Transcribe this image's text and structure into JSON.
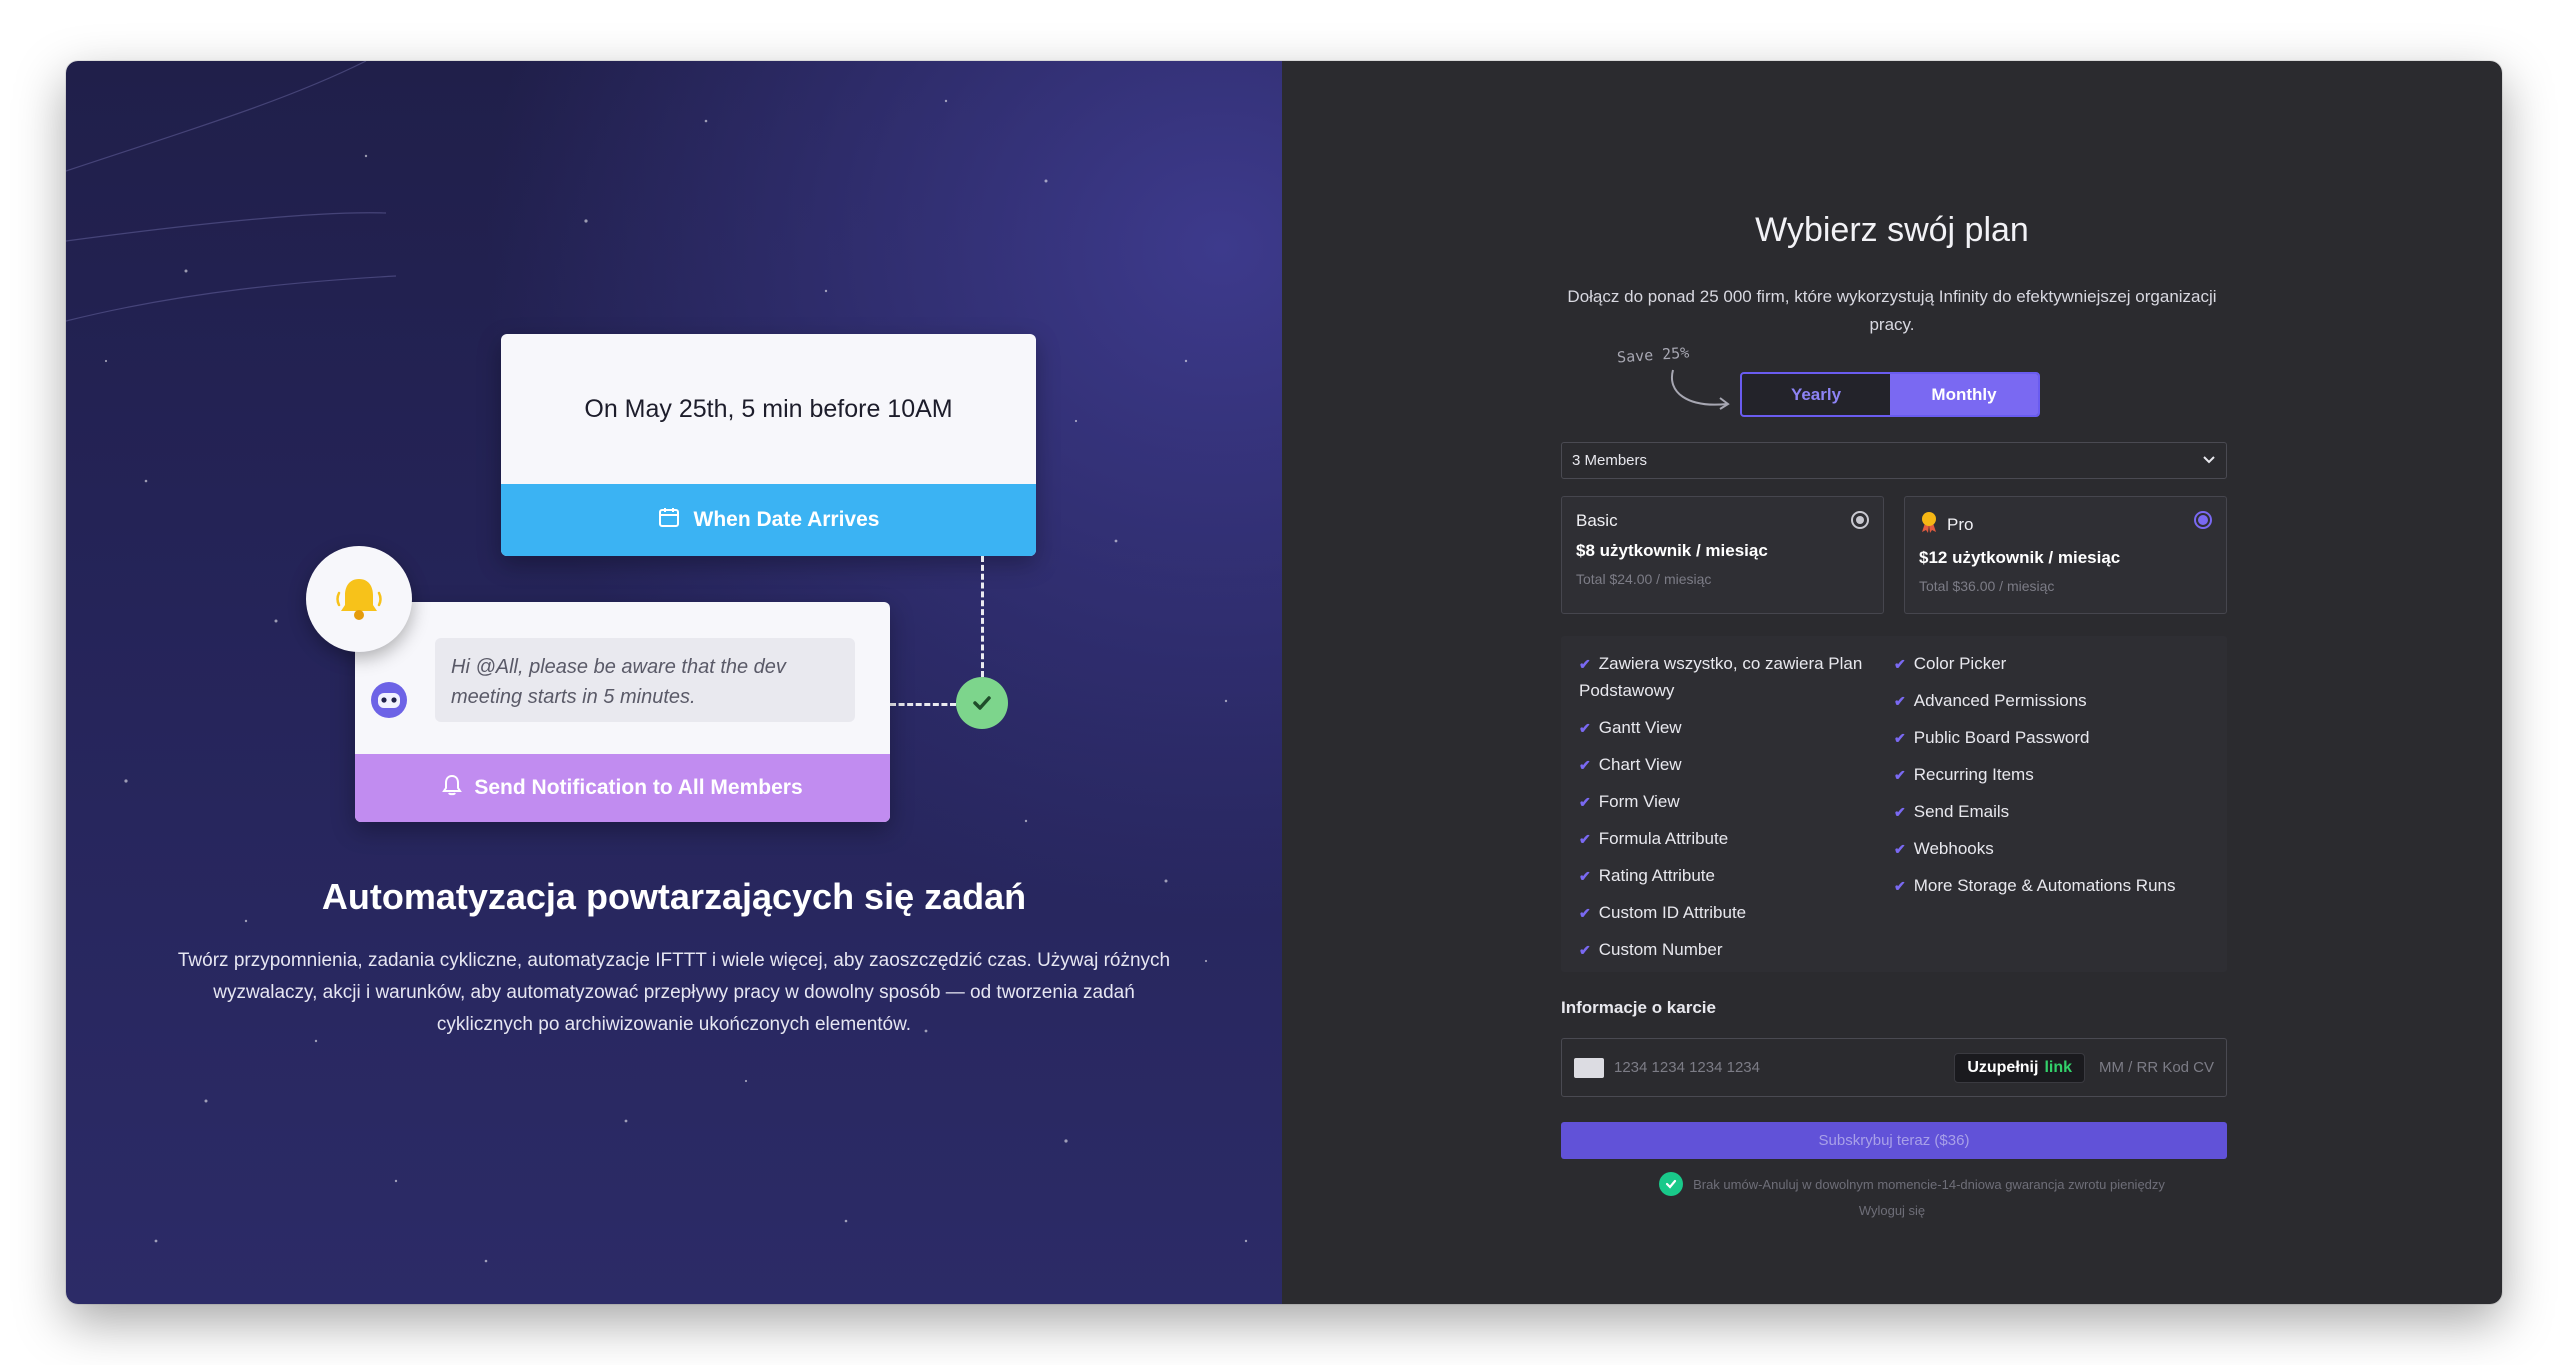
{
  "left": {
    "trigger_text": "On May 25th, 5 min before 10AM",
    "trigger_bar": "When Date Arrives",
    "message": "Hi @All, please be aware that the dev meeting starts in 5 minutes.",
    "notify_bar": "Send Notification to All Members",
    "title": "Automatyzacja powtarzających się zadań",
    "description": "Twórz przypomnienia, zadania cykliczne, automatyzacje IFTTT i wiele więcej, aby zaoszczędzić czas. Używaj różnych wyzwalaczy, akcji i warunków, aby automatyzować przepływy pracy w dowolny sposób — od tworzenia zadań cyklicznych po archiwizowanie ukończonych elementów."
  },
  "right": {
    "title": "Wybierz swój plan",
    "subtitle": "Dołącz do ponad 25 000 firm, które wykorzystują Infinity do efektywniejszej organizacji pracy.",
    "save_note": "Save 25%",
    "billing": {
      "yearly": "Yearly",
      "monthly": "Monthly",
      "selected": "Monthly"
    },
    "members_select": "3 Members",
    "plans": [
      {
        "name": "Basic",
        "price": "$8 użytkownik / miesiąc",
        "total": "Total $24.00 / miesiąc",
        "selected": false
      },
      {
        "name": "Pro",
        "price": "$12 użytkownik / miesiąc",
        "total": "Total $36.00 / miesiąc",
        "selected": true
      }
    ],
    "features_left": [
      "Zawiera wszystko, co zawiera Plan",
      "Podstawowy",
      "Gantt View",
      "Chart View",
      "Form View",
      "Formula Attribute",
      "Rating Attribute",
      "Custom ID Attribute",
      "Custom Number"
    ],
    "features_right": [
      "Color Picker",
      "Advanced Permissions",
      "Public Board Password",
      "Recurring Items",
      "Send Emails",
      "Webhooks",
      "More Storage & Automations Runs"
    ],
    "card_label": "Informacje o karcie",
    "card_placeholder": "1234 1234 1234 1234",
    "link_button": {
      "text": "Uzupełnij",
      "link": "link"
    },
    "expiry_placeholder": "MM / RR Kod CVC",
    "subscribe": "Subskrybuj teraz ($36)",
    "guarantee": "Brak umów-Anuluj w dowolnym momencie-14-dniowa gwarancja zwrotu pieniędzy",
    "logout": "Wyloguj się"
  },
  "colors": {
    "accent": "#7a69f2",
    "trigger_blue": "#3bb3f3",
    "notify_purple": "#c18cf0",
    "success_green": "#7dd58c",
    "dark_bg": "#2b2b2f"
  }
}
